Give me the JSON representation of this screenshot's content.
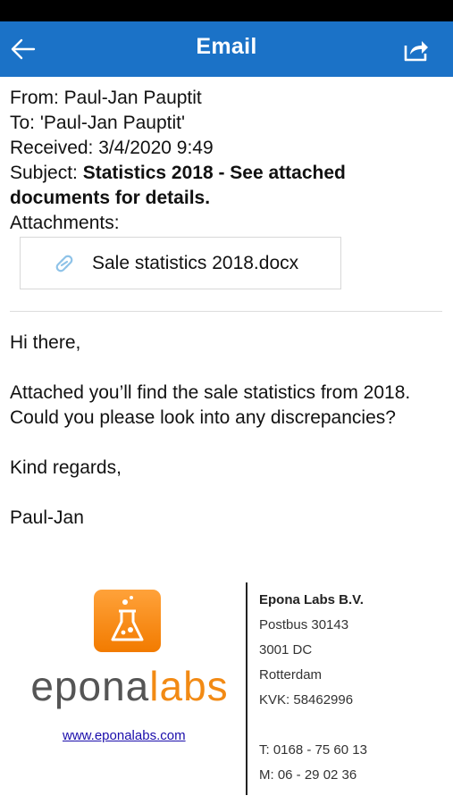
{
  "appbar": {
    "title": "Email"
  },
  "meta": {
    "from": "From: Paul-Jan Pauptit",
    "to": "To: 'Paul-Jan Pauptit'",
    "received": "Received: 3/4/2020 9:49",
    "subject_prefix": "Subject: ",
    "subject": "Statistics 2018 - See attached documents for details.",
    "attachments_label": "Attachments:"
  },
  "attachment": {
    "file_name": "Sale statistics 2018.docx",
    "icon": "paperclip-icon"
  },
  "body": {
    "greeting": "Hi there,",
    "line1": "Attached you’ll find the sale statistics from 2018.",
    "line2": "Could you please look into any discrepancies?",
    "closing": "Kind regards,",
    "name": "Paul-Jan"
  },
  "signature": {
    "logo_part1": "epona",
    "logo_part2": "labs",
    "website": "www.eponalabs.com",
    "company": "Epona Labs B.V.",
    "address1": "Postbus 30143",
    "address2": "3001 DC",
    "city": "Rotterdam",
    "kvk": "KVK: 58462996",
    "phone": "T: 0168 - 75 60 13",
    "mobile": "M: 06 - 29 02 36"
  },
  "colors": {
    "appbar": "#1b72c7",
    "logo_orange": "#f28a14",
    "link": "#1a0dab"
  }
}
